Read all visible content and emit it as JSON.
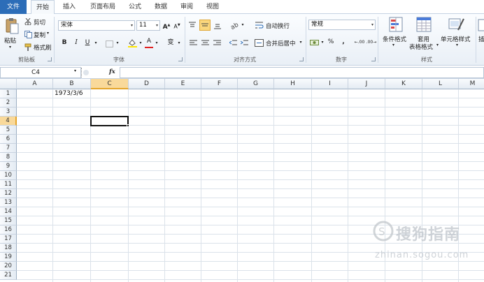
{
  "tabs": {
    "file": "文件",
    "home": "开始",
    "insert": "插入",
    "page_layout": "页面布局",
    "formulas": "公式",
    "data": "数据",
    "review": "审阅",
    "view": "视图"
  },
  "clipboard": {
    "paste": "粘贴",
    "cut": "剪切",
    "copy": "复制",
    "format_painter": "格式刷",
    "group_label": "剪贴板"
  },
  "font": {
    "name": "宋体",
    "size": "11",
    "bold": "B",
    "italic": "I",
    "underline": "U",
    "grow": "A",
    "shrink": "A",
    "font_color_letter": "A",
    "phonetic": "变",
    "group_label": "字体"
  },
  "alignment": {
    "wrap_text": "自动换行",
    "merge_center": "合并后居中",
    "group_label": "对齐方式"
  },
  "number": {
    "format": "常规",
    "percent": "%",
    "comma": ",",
    "inc_decimal": ".00",
    "dec_decimal": ".00",
    "group_label": "数字"
  },
  "styles": {
    "conditional": "条件格式",
    "table_line1": "套用",
    "table_line2": "表格格式",
    "cell_styles": "单元格样式",
    "group_label": "样式"
  },
  "cells_group": {
    "insert_partial": "插"
  },
  "formula_bar": {
    "name_box": "C4",
    "fx": "fx",
    "content": ""
  },
  "columns": [
    "A",
    "B",
    "C",
    "D",
    "E",
    "F",
    "G",
    "H",
    "I",
    "J",
    "K",
    "L",
    "M"
  ],
  "rows": [
    "1",
    "2",
    "3",
    "4",
    "5",
    "6",
    "7",
    "8",
    "9",
    "10",
    "11",
    "12",
    "13",
    "14",
    "15",
    "16",
    "17",
    "18",
    "19",
    "20",
    "21"
  ],
  "cells": {
    "B1": "1973/3/6"
  },
  "selected_cell": "C4",
  "watermark": {
    "brand": "搜狗指南",
    "url": "zhinan.sogou.com"
  },
  "colors": {
    "file_tab": "#2c6db8",
    "selection_header": "#f9d99a",
    "selection_accent": "#e4a52c"
  }
}
